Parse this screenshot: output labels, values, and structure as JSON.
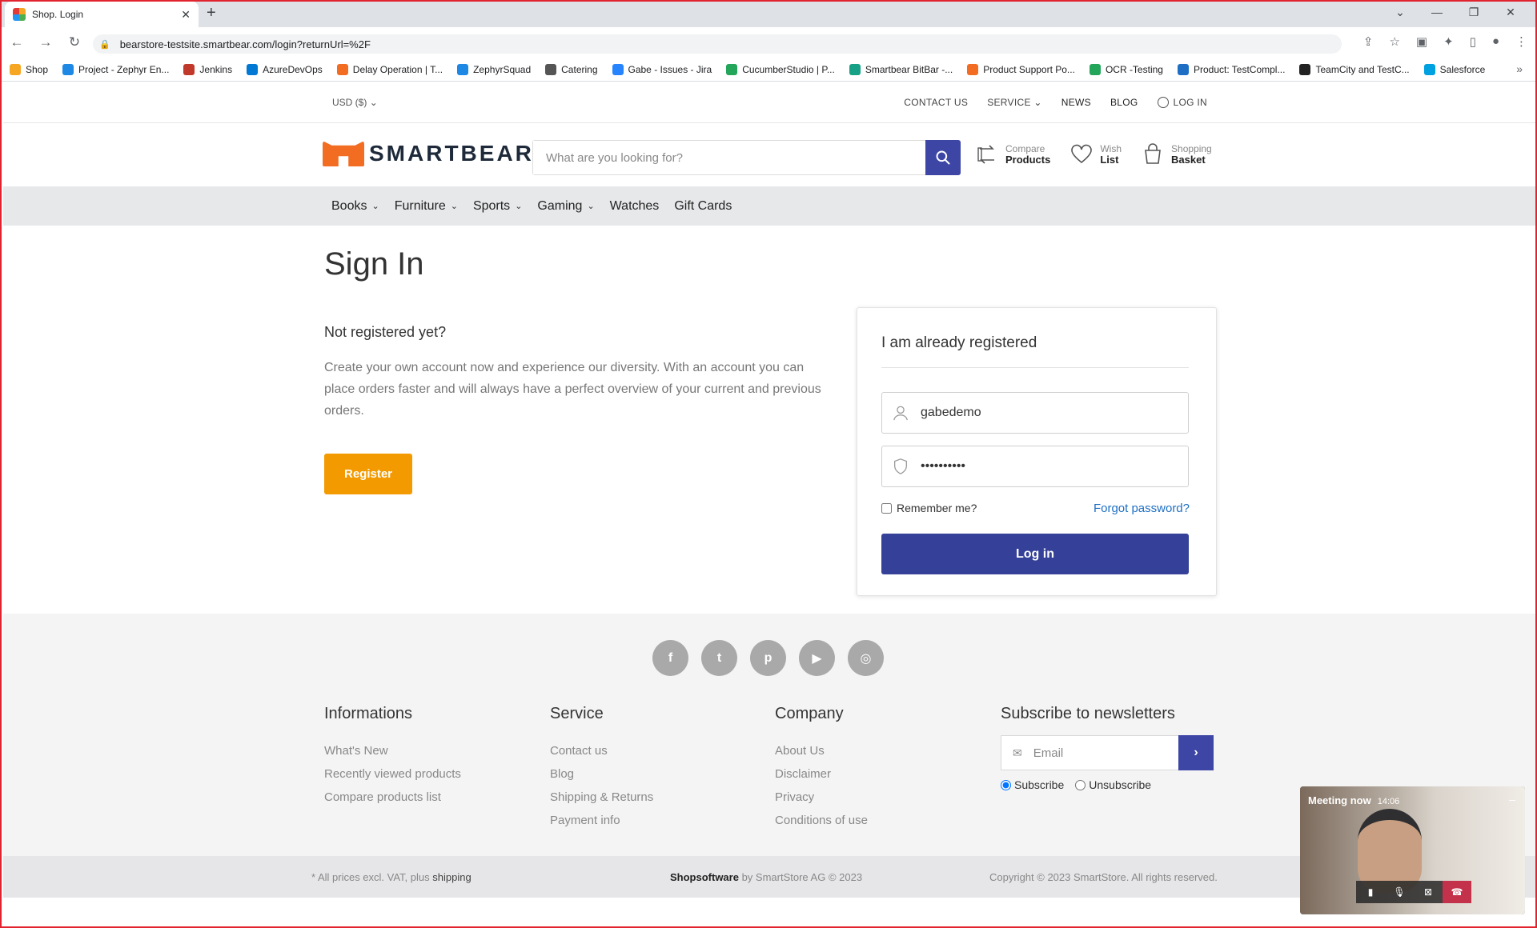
{
  "browser": {
    "tab_title": "Shop. Login",
    "url": "bearstore-testsite.smartbear.com/login?returnUrl=%2F",
    "bookmarks": [
      {
        "label": "Shop",
        "color": "#f5a623"
      },
      {
        "label": "Project - Zephyr En...",
        "color": "#1e88e5"
      },
      {
        "label": "Jenkins",
        "color": "#c0392b"
      },
      {
        "label": "AzureDevOps",
        "color": "#0078d4"
      },
      {
        "label": "Delay Operation | T...",
        "color": "#f26c21"
      },
      {
        "label": "ZephyrSquad",
        "color": "#1e88e5"
      },
      {
        "label": "Catering",
        "color": "#555555"
      },
      {
        "label": "Gabe - Issues - Jira",
        "color": "#2684ff"
      },
      {
        "label": "CucumberStudio | P...",
        "color": "#23a55a"
      },
      {
        "label": "Smartbear BitBar -...",
        "color": "#16a085"
      },
      {
        "label": "Product Support Po...",
        "color": "#f26c21"
      },
      {
        "label": "OCR -Testing",
        "color": "#23a55a"
      },
      {
        "label": "Product: TestCompl...",
        "color": "#1e6fc4"
      },
      {
        "label": "TeamCity and TestC...",
        "color": "#222222"
      },
      {
        "label": "Salesforce",
        "color": "#00a1e0"
      }
    ]
  },
  "topbar": {
    "currency": "USD  ($)",
    "contact": "CONTACT US",
    "service": "SERVICE",
    "news": "NEWS",
    "blog": "BLOG",
    "login": "LOG IN"
  },
  "header": {
    "brand": "SMARTBEAR",
    "search_placeholder": "What are you looking for?",
    "compare_l1": "Compare",
    "compare_l2": "Products",
    "wish_l1": "Wish",
    "wish_l2": "List",
    "basket_l1": "Shopping",
    "basket_l2": "Basket"
  },
  "categories": [
    "Books",
    "Furniture",
    "Sports",
    "Gaming",
    "Watches",
    "Gift Cards"
  ],
  "main": {
    "title": "Sign In",
    "not_registered": "Not registered yet?",
    "not_registered_text": "Create your own account now and experience our diversity. With an account you can place orders faster and will always have a perfect overview of your current and previous orders.",
    "register_label": "Register"
  },
  "login_card": {
    "heading": "I am already registered",
    "username_value": "gabedemo",
    "password_value": "gabedemo12",
    "remember_label": "Remember me?",
    "forgot_label": "Forgot password?",
    "login_label": "Log in"
  },
  "footer": {
    "social": [
      "f",
      "t",
      "p",
      "▶",
      "◎"
    ],
    "informations": {
      "heading": "Informations",
      "links": [
        "What's New",
        "Recently viewed products",
        "Compare products list"
      ]
    },
    "service": {
      "heading": "Service",
      "links": [
        "Contact us",
        "Blog",
        "Shipping & Returns",
        "Payment info"
      ]
    },
    "company": {
      "heading": "Company",
      "links": [
        "About Us",
        "Disclaimer",
        "Privacy",
        "Conditions of use"
      ]
    },
    "newsletter": {
      "heading": "Subscribe to newsletters",
      "placeholder": "Email",
      "subscribe": "Subscribe",
      "unsubscribe": "Unsubscribe"
    },
    "prices_note": "* All prices excl. VAT, plus ",
    "shipping_link": "shipping",
    "shopsoftware": "Shopsoftware",
    "by_text": " by SmartStore AG © 2023",
    "copyright": "Copyright © 2023 SmartStore. All rights reserved."
  },
  "meeting": {
    "title": "Meeting now",
    "time": "14:06"
  },
  "colors": {
    "accent_blue": "#354098",
    "register_orange": "#f29a00",
    "brand_orange": "#f26c21"
  }
}
